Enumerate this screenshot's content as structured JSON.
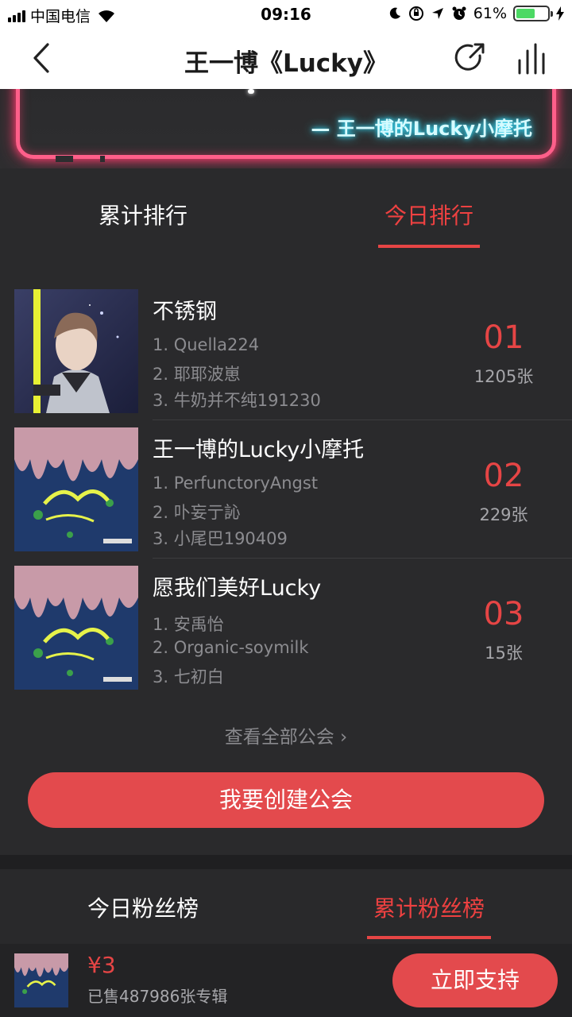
{
  "status_bar": {
    "carrier": "中国电信",
    "time": "09:16",
    "battery": "61%",
    "battery_level": 0.61,
    "icons": [
      "signal-icon",
      "wifi-icon",
      "moon-icon",
      "rotation-lock-icon",
      "location-icon",
      "alarm-icon",
      "battery-icon",
      "charging-icon"
    ]
  },
  "nav": {
    "title": "王一博《Lucky》",
    "back_icon": "back-chevron-icon",
    "share_icon": "share-icon",
    "chart_icon": "bars-chart-icon"
  },
  "banner": {
    "neon_text": "— 王一博的Lucky小摩托"
  },
  "ranking_tabs": [
    {
      "label": "累计排行",
      "active": false
    },
    {
      "label": "今日排行",
      "active": true
    }
  ],
  "rankings": [
    {
      "name": "不锈钢",
      "members": [
        "1. Quella224",
        "2. 耶耶波崽",
        "3. 牛奶并不纯191230"
      ],
      "rank": "01",
      "count": "1205张"
    },
    {
      "name": "王一博的Lucky小摩托",
      "members": [
        "1. PerfunctoryAngst",
        "2. 卟妄亍訫",
        "3. 小尾巴190409"
      ],
      "rank": "02",
      "count": "229张"
    },
    {
      "name": "愿我们美好Lucky",
      "members": [
        "1. 安禹怡",
        "2. Organic-soymilk",
        "3. 七初白"
      ],
      "rank": "03",
      "count": "15张"
    }
  ],
  "view_all": "查看全部公会 ›",
  "create_button": "我要创建公会",
  "fan_tabs": [
    {
      "label": "今日粉丝榜",
      "active": false
    },
    {
      "label": "累计粉丝榜",
      "active": true
    }
  ],
  "bottom_bar": {
    "price": "¥3",
    "sold": "已售487986张专辑",
    "support_button": "立即支持"
  },
  "colors": {
    "accent": "#e64545",
    "neon_pink": "#ff5f8a",
    "neon_cyan": "#35e0ff",
    "background": "#2a2a2c"
  }
}
